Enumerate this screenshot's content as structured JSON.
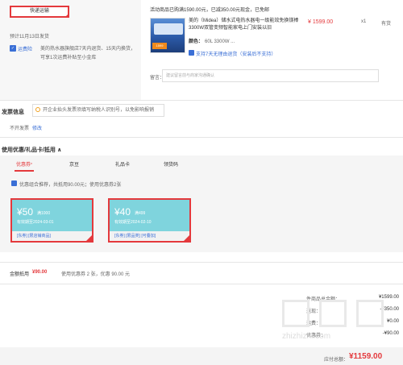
{
  "shipping": {
    "delivery_label": "快递运输",
    "est_date": "预计11月13日发货",
    "guard_title": "运费险",
    "guard_desc": "美的热水器旗舰店7天内退货、15天内换货，可享1次运费补贴至小金库"
  },
  "product": {
    "promo": "活动商品已购满1590.00元，已减350.00元现金，已免邮",
    "title": "美的（Midea）储水式电热水器电一级能效免换镁棒3300W双管变频智能家电上门安装以旧",
    "color_label": "颜色：",
    "color_value": "60L 3300W ...",
    "return_text": "支持7天无理由退货（安装后不支持）",
    "price": "¥ 1599.00",
    "qty": "x1",
    "stock": "有货",
    "img_badge": "1599"
  },
  "message": {
    "label": "留言：",
    "placeholder": "建议留言前与商家沟通确认"
  },
  "invoice": {
    "title": "发票信息",
    "note": "开企业抬头发票须填写纳税人识别号，以免影响报销",
    "type": "不开发票",
    "edit": "修改"
  },
  "coupons": {
    "title": "使用优惠/礼品卡/抵用 ∧",
    "tabs": [
      {
        "label": "优惠券",
        "star": "*"
      },
      {
        "label": "京豆",
        "star": ""
      },
      {
        "label": "礼品卡",
        "star": ""
      },
      {
        "label": "领货码",
        "star": ""
      }
    ],
    "check_text": "优惠组合推荐，共抵用90.00元；使用优惠券2张",
    "items": [
      {
        "amount": "¥50",
        "condition": "满1000",
        "valid": "有效期至2024-03-01",
        "tags": "[东券]  [限店铺商品]",
        "selected": true
      },
      {
        "amount": "¥40",
        "condition": "满499",
        "valid": "有效期至2024-02-10",
        "tags": "[东券]  [限品类]  [可叠加]",
        "selected": true
      }
    ]
  },
  "summary_amount": {
    "label": "金额抵用",
    "value": "¥90.00",
    "desc": "使用优惠券 2 张，优惠 90.00 元"
  },
  "summary": {
    "rows": [
      {
        "label": "件商品总金额：",
        "value": "¥1599.00"
      },
      {
        "label": "返现：",
        "value": "-¥350.00"
      },
      {
        "label": "运费：",
        "value": "¥0.00"
      },
      {
        "label": "优惠券：",
        "value": "-¥90.00"
      }
    ]
  },
  "footer": {
    "pay_label": "应付总额：",
    "pay_value": "¥1159.00"
  },
  "watermark": {
    "text": "zhizhizhi.com"
  }
}
